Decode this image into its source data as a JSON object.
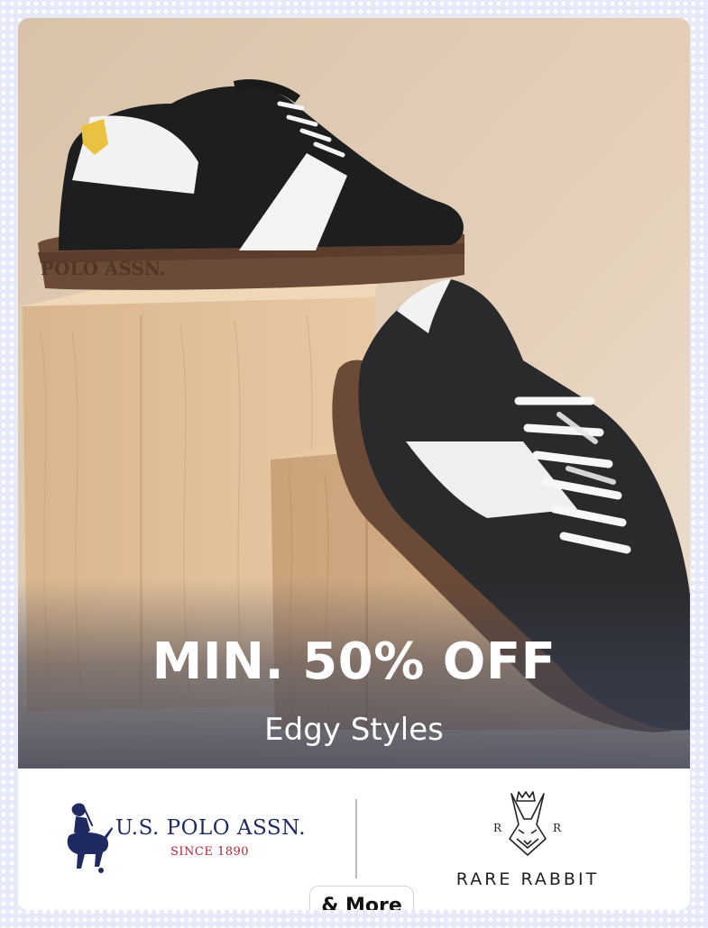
{
  "banner": {
    "headline": "MIN. 50% OFF",
    "subheadline": "Edgy Styles",
    "image_alt_icon": "sneakers-product-photo"
  },
  "brands": [
    {
      "name": "U.S. POLO ASSN.",
      "tagline": "SINCE 1890",
      "logo_icon": "polo-player-icon"
    },
    {
      "name": "RARE RABBIT",
      "tagline": "",
      "logo_icon": "rabbit-head-icon"
    }
  ],
  "more_button": {
    "label": "& More"
  },
  "colors": {
    "uspa_navy": "#1f2a63",
    "uspa_red": "#b0233a",
    "background_pattern": "#e7e9f8"
  }
}
